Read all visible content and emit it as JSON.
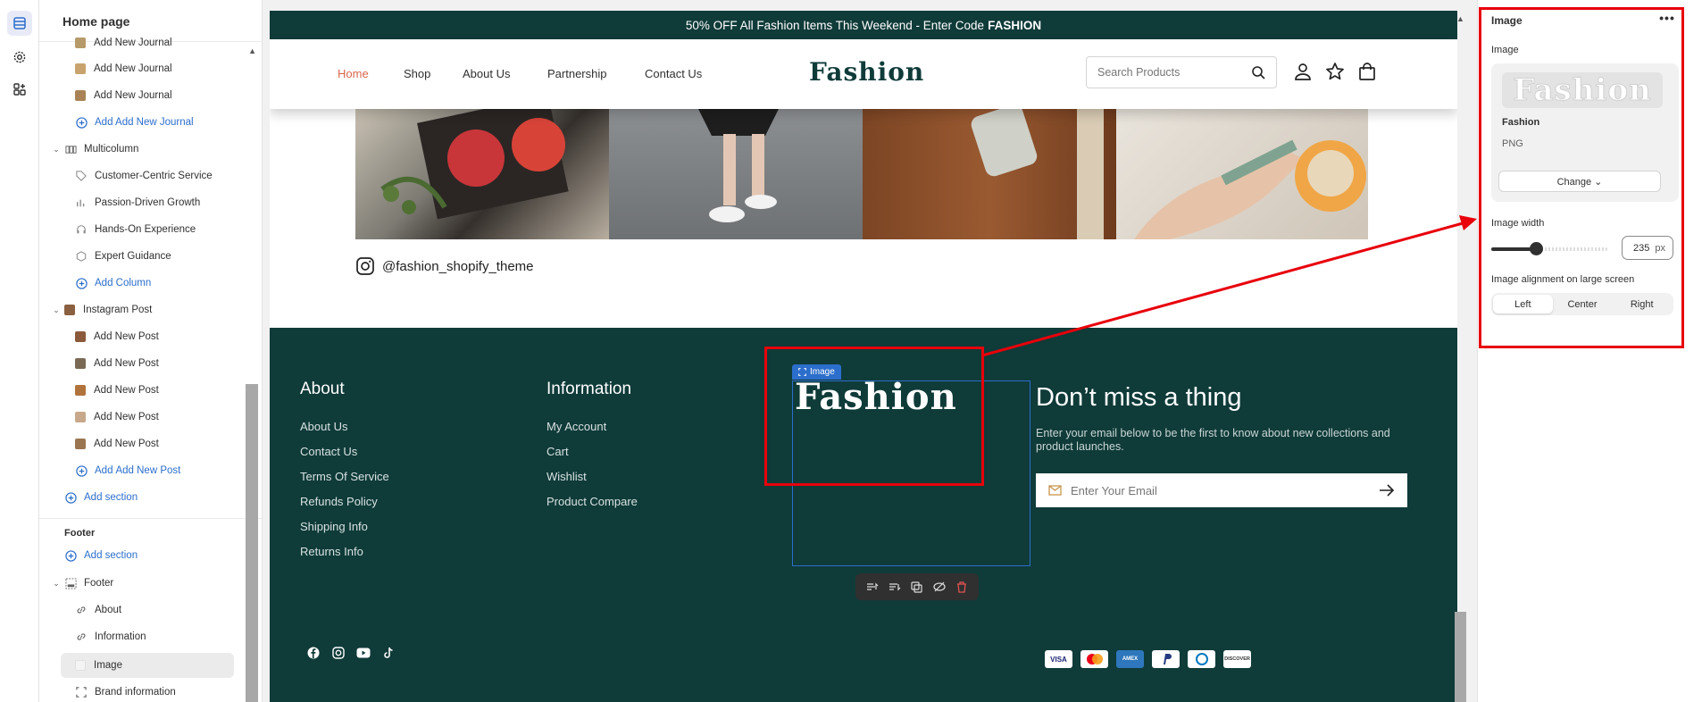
{
  "sidebar": {
    "title": "Home page",
    "items": [
      {
        "label": "Add New Journal",
        "kind": "child",
        "thumb": "#b79a6a"
      },
      {
        "label": "Add New Journal",
        "kind": "child",
        "thumb": "#c9a36d"
      },
      {
        "label": "Add New Journal",
        "kind": "child",
        "thumb": "#a98356"
      },
      {
        "label": "Add Add New Journal",
        "kind": "add"
      },
      {
        "label": "Multicolumn",
        "kind": "section"
      },
      {
        "label": "Customer-Centric Service",
        "kind": "child-icon",
        "icon": "tag-icon"
      },
      {
        "label": "Passion-Driven Growth",
        "kind": "child-icon",
        "icon": "chart-icon"
      },
      {
        "label": "Hands-On Experience",
        "kind": "child-icon",
        "icon": "headset-icon"
      },
      {
        "label": "Expert Guidance",
        "kind": "child-icon",
        "icon": "cube-icon"
      },
      {
        "label": "Add Column",
        "kind": "add"
      },
      {
        "label": "Instagram Post",
        "kind": "section"
      },
      {
        "label": "Add New Post",
        "kind": "child",
        "thumb": "#8a5a3b"
      },
      {
        "label": "Add New Post",
        "kind": "child",
        "thumb": "#7a6a55"
      },
      {
        "label": "Add New Post",
        "kind": "child",
        "thumb": "#b0733c"
      },
      {
        "label": "Add New Post",
        "kind": "child",
        "thumb": "#c8a88a"
      },
      {
        "label": "Add New Post",
        "kind": "child",
        "thumb": "#9a7650"
      },
      {
        "label": "Add New Post",
        "kind": "add"
      },
      {
        "label": "Add section",
        "kind": "add-section"
      }
    ],
    "footer_group": {
      "title": "Footer",
      "add_section": "Add section",
      "section": "Footer",
      "children": [
        {
          "label": "About",
          "icon": "link-icon"
        },
        {
          "label": "Information",
          "icon": "link-icon"
        },
        {
          "label": "Image",
          "icon": "image-icon"
        },
        {
          "label": "Brand information",
          "icon": "frame-icon"
        }
      ]
    }
  },
  "preview": {
    "announcement": {
      "text": "50% OFF All Fashion Items This Weekend - Enter Code",
      "code": "FASHION"
    },
    "nav": [
      "Home",
      "Shop",
      "About Us",
      "Partnership",
      "Contact Us"
    ],
    "logo": "Fashion",
    "search_placeholder": "Search Products",
    "instagram_handle": "@fashion_shopify_theme",
    "footer": {
      "about_title": "About",
      "about_links": [
        "About Us",
        "Contact Us",
        "Terms Of Service",
        "Refunds Policy",
        "Shipping Info",
        "Returns Info"
      ],
      "info_title": "Information",
      "info_links": [
        "My Account",
        "Cart",
        "Wishlist",
        "Product Compare"
      ],
      "image_tag": "Image",
      "logo": "Fashion",
      "news_title": "Don’t miss a thing",
      "news_desc": "Enter your email below to be the first to know about new collections and product launches.",
      "email_placeholder": "Enter Your Email",
      "payments": [
        "VISA",
        "MC",
        "AMEX",
        "PayPal",
        "Diners",
        "DISCOVER"
      ]
    }
  },
  "inspector": {
    "title": "Image",
    "more": "•••",
    "image_label": "Image",
    "image_preview_text": "Fashion",
    "file_name": "Fashion",
    "file_type": "PNG",
    "change_label": "Change ⌄",
    "width_label": "Image width",
    "width_value": "235",
    "width_unit": "px",
    "align_label": "Image alignment on large screen",
    "align_options": [
      "Left",
      "Center",
      "Right"
    ],
    "align_selected": "Left"
  },
  "colors": {
    "brand_dark": "#0f3b39",
    "accent": "#d9664c",
    "link": "#2c6ecb",
    "highlight": "#e8000b"
  }
}
